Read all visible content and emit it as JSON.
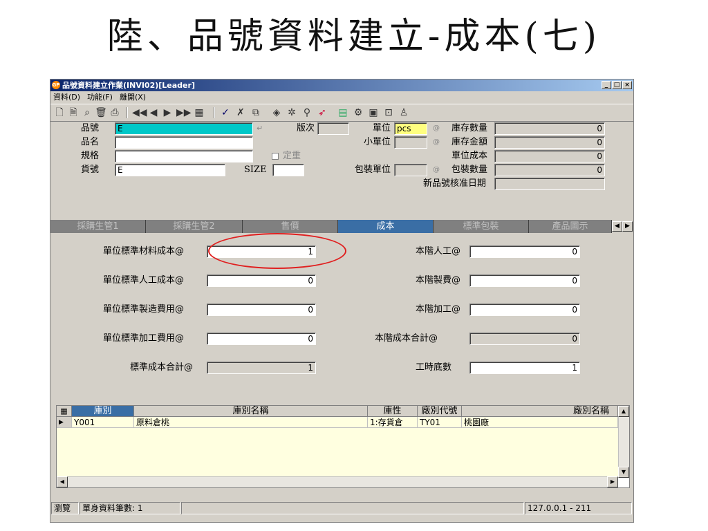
{
  "slide": {
    "title": "陸、品號資料建立-成本(七)"
  },
  "window": {
    "title": "品號資料建立作業(INVI02)[Leader]",
    "menu": [
      "資料(D)",
      "功能(F)",
      "離開(X)"
    ]
  },
  "toolbar": {
    "icons": [
      "new-icon",
      "preview-icon",
      "find-icon",
      "delete-icon",
      "print-icon",
      "first-icon",
      "prev-icon",
      "next-icon",
      "last-icon",
      "browse-icon",
      "confirm-icon",
      "cancel-icon",
      "copy-icon",
      "tool1-icon",
      "tool2-icon",
      "tool3-icon",
      "tool4-icon",
      "tool5-icon",
      "tool6-icon",
      "tool7-icon",
      "tool8-icon",
      "tool9-icon"
    ]
  },
  "header": {
    "item_no": {
      "label": "品號",
      "value": "E"
    },
    "version": {
      "label": "版次",
      "value": ""
    },
    "unit": {
      "label": "單位",
      "value": "pcs"
    },
    "stock_qty": {
      "label": "庫存數量",
      "value": "0"
    },
    "item_name": {
      "label": "品名",
      "value": ""
    },
    "small_unit": {
      "label": "小單位",
      "value": ""
    },
    "stock_amount": {
      "label": "庫存金額",
      "value": "0"
    },
    "spec": {
      "label": "規格",
      "value": ""
    },
    "fixed_weight": {
      "label": "定重"
    },
    "unit_cost": {
      "label": "單位成本",
      "value": "0"
    },
    "goods_no": {
      "label": "貨號",
      "value": "E"
    },
    "size": {
      "label": "SIZE",
      "value": ""
    },
    "pack_unit": {
      "label": "包裝單位",
      "value": ""
    },
    "pack_qty": {
      "label": "包裝數量",
      "value": "0"
    },
    "approve_date": {
      "label": "新品號核准日期",
      "value": ""
    }
  },
  "tabs": [
    "採購生管1",
    "採購生管2",
    "售價",
    "成本",
    "標準包裝",
    "產品圖示"
  ],
  "cost": {
    "std_material": {
      "label": "單位標準材料成本@",
      "value": "1"
    },
    "std_labor": {
      "label": "單位標準人工成本@",
      "value": "0"
    },
    "std_overhead": {
      "label": "單位標準製造費用@",
      "value": "0"
    },
    "std_processing": {
      "label": "單位標準加工費用@",
      "value": "0"
    },
    "std_total": {
      "label": "標準成本合計@",
      "value": "1"
    },
    "level_labor": {
      "label": "本階人工@",
      "value": "0"
    },
    "level_overhead": {
      "label": "本階製費@",
      "value": "0"
    },
    "level_processing": {
      "label": "本階加工@",
      "value": "0"
    },
    "level_total": {
      "label": "本階成本合計@",
      "value": "0"
    },
    "hours_base": {
      "label": "工時底數",
      "value": "1"
    }
  },
  "grid": {
    "headers": [
      "庫別",
      "庫別名稱",
      "庫性",
      "廠別代號",
      "廠別名稱"
    ],
    "rows": [
      [
        "Y001",
        "原料倉桃",
        "1:存貨倉",
        "TY01",
        "桃園廠"
      ]
    ]
  },
  "status": {
    "mode": "瀏覽",
    "count": "單身資料筆數: 1",
    "server": "127.0.0.1 - 211"
  },
  "colors": {
    "title_bar": "#0a246a",
    "active_tab": "#3a6ea5",
    "item_field": "#00c8c8",
    "unit_field": "#ffff80",
    "highlight": "#e02020"
  }
}
